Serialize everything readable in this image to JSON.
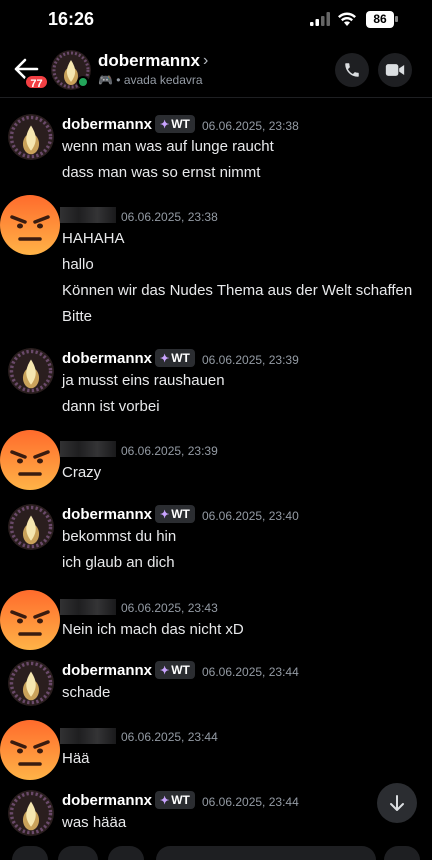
{
  "status_bar": {
    "time": "16:26",
    "battery": "86"
  },
  "header": {
    "badge_count": "77",
    "name": "dobermannx",
    "chevron": "›",
    "status_text": "• avada kedavra",
    "icons": [
      "back-arrow-icon",
      "phone-icon",
      "video-icon"
    ]
  },
  "messages": [
    {
      "author": "dobermannx",
      "tag": "WT",
      "timestamp": "06.06.2025, 23:38",
      "lines": [
        "wenn man was auf lunge raucht",
        "dass man was so ernst nimmt"
      ]
    },
    {
      "author": "",
      "tag": "",
      "timestamp": "06.06.2025, 23:38",
      "lines": [
        "HAHAHA",
        "hallo",
        "Können wir das Nudes Thema aus der Welt schaffen",
        "Bitte"
      ]
    },
    {
      "author": "dobermannx",
      "tag": "WT",
      "timestamp": "06.06.2025, 23:39",
      "lines": [
        "ja musst eins raushauen",
        "dann ist vorbei"
      ]
    },
    {
      "author": "",
      "tag": "",
      "timestamp": "06.06.2025, 23:39",
      "lines": [
        "Crazy"
      ]
    },
    {
      "author": "dobermannx",
      "tag": "WT",
      "timestamp": "06.06.2025, 23:40",
      "lines": [
        "bekommst du hin",
        "ich glaub an dich"
      ]
    },
    {
      "author": "",
      "tag": "",
      "timestamp": "06.06.2025, 23:43",
      "lines": [
        "Nein ich mach das nicht xD"
      ]
    },
    {
      "author": "dobermannx",
      "tag": "WT",
      "timestamp": "06.06.2025, 23:44",
      "lines": [
        "schade"
      ]
    },
    {
      "author": "",
      "tag": "",
      "timestamp": "06.06.2025, 23:44",
      "lines": [
        "Hää"
      ]
    },
    {
      "author": "dobermannx",
      "tag": "WT",
      "timestamp": "06.06.2025, 23:44",
      "lines": [
        "was hääa"
      ]
    }
  ],
  "colors": {
    "background": "#000000",
    "online": "#23a55a",
    "badge": "#f23f43",
    "angry_top": "#ff6b2c",
    "angry_bottom": "#ffb347"
  }
}
